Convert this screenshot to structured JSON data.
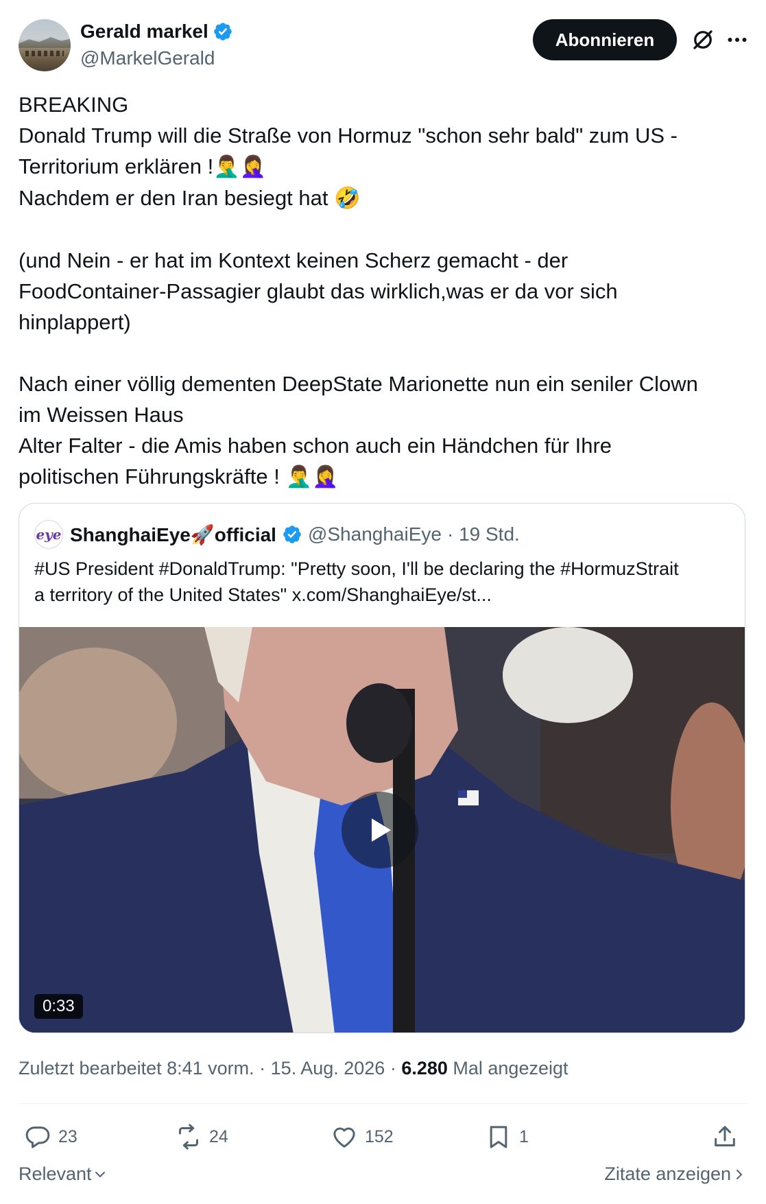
{
  "author": {
    "display_name": "Gerald markel",
    "handle": "@MarkelGerald",
    "follow_label": "Abonnieren"
  },
  "tweet": {
    "lines": [
      "BREAKING",
      "Donald Trump will die Straße von Hormuz \"schon sehr bald\" zum US -",
      "Territorium erklären !",
      "Nachdem er den Iran besiegt hat",
      "(und Nein - er hat im Kontext keinen Scherz gemacht - der",
      "FoodContainer-Passagier glaubt das wirklich,was er da vor sich",
      "hinplappert)",
      "Nach einer völlig dementen DeepState Marionette nun ein seniler Clown",
      "im Weissen Haus",
      "Alter Falter - die Amis haben schon auch ein Händchen für Ihre",
      "politischen Führungskräfte !"
    ],
    "emoji_facepalm": "🤦‍♂️🤦‍♀️",
    "emoji_laugh": "🤣"
  },
  "quote": {
    "avatar_text": "eye",
    "display_name": "ShanghaiEye",
    "name_rocket": "🚀",
    "name_suffix": "official",
    "handle": "@ShanghaiEye",
    "time": "· 19 Std.",
    "text_line1": "#US President #DonaldTrump: \"Pretty soon, I'll be declaring the #HormuzStrait",
    "text_line2": "a territory of the United States\"  x.com/ShanghaiEye/st...",
    "video_duration": "0:33"
  },
  "meta": {
    "edited": "Zuletzt bearbeitet 8:41 vorm. · 15. Aug. 2026 · ",
    "views_count": "6.280",
    "views_label": " Mal angezeigt"
  },
  "actions": {
    "replies": "23",
    "reposts": "24",
    "likes": "152",
    "bookmarks": "1"
  },
  "footer": {
    "sort_label": "Relevant",
    "quotes_label": "Zitate anzeigen"
  },
  "colors": {
    "verified": "#1d9bf0",
    "primary_text": "#0f1419",
    "secondary_text": "#536471",
    "border": "#cfd9de"
  },
  "icons": [
    "verified-badge-icon",
    "grok-icon",
    "more-icon",
    "play-icon",
    "reply-icon",
    "repost-icon",
    "like-icon",
    "bookmark-icon",
    "share-icon",
    "chevron-down-icon",
    "chevron-right-icon"
  ]
}
